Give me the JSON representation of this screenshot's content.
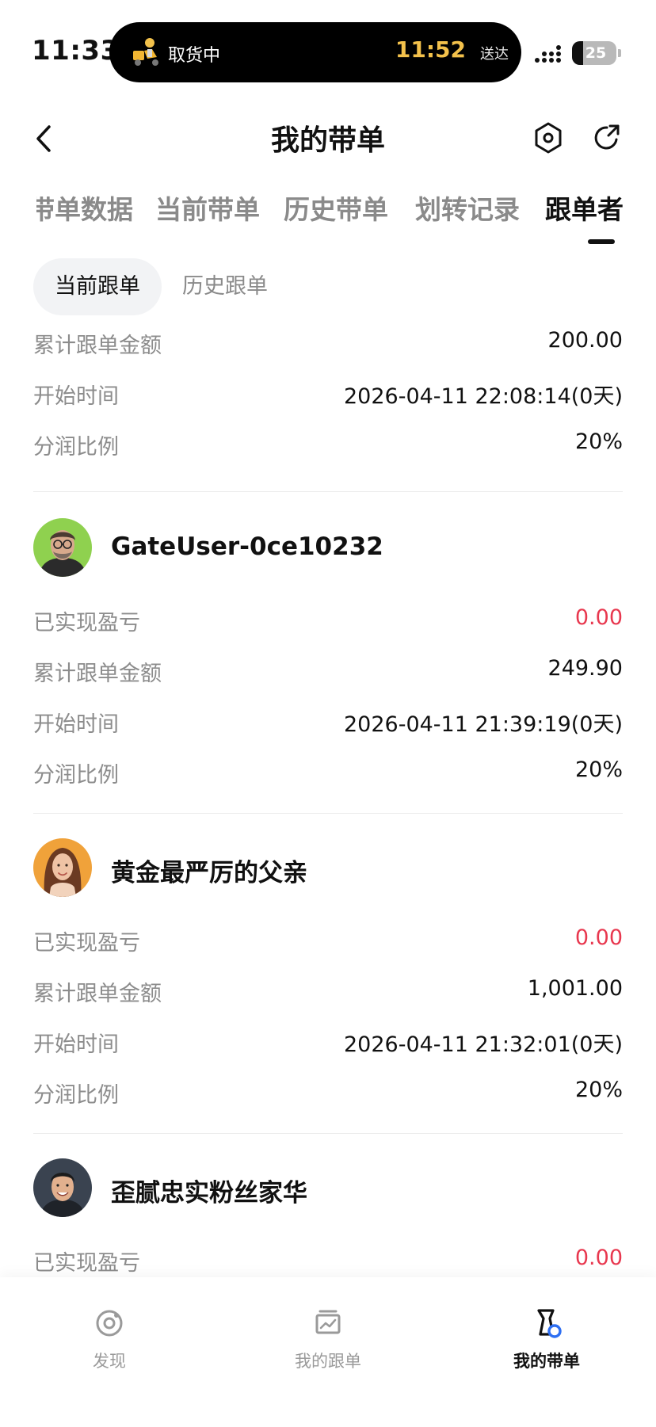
{
  "status_bar": {
    "time": "11:33",
    "delivery_status": "取货中",
    "delivery_eta": "11:52",
    "delivery_eta_suffix": "送达",
    "battery": "25"
  },
  "header": {
    "title": "我的带单",
    "icons": {
      "back": "chevron-left-icon",
      "settings": "hexagon-settings-icon",
      "share": "share-icon"
    }
  },
  "main_tabs": [
    {
      "label": "带单数据"
    },
    {
      "label": "当前带单"
    },
    {
      "label": "历史带单"
    },
    {
      "label": "划转记录"
    },
    {
      "label": "跟单者",
      "active": true
    }
  ],
  "sub_tabs": [
    {
      "label": "当前跟单",
      "active": true
    },
    {
      "label": "历史跟单"
    }
  ],
  "labels": {
    "realized_pnl": "已实现盈亏",
    "total_amount": "累计跟单金额",
    "start_time": "开始时间",
    "profit_share": "分润比例"
  },
  "partial_top": {
    "total_amount": "200.00",
    "start_time": "2026-04-11 22:08:14(0天)",
    "profit_share": "20%"
  },
  "followers": [
    {
      "name": "GateUser-0ce10232",
      "realized_pnl": "0.00",
      "total_amount": "249.90",
      "start_time": "2026-04-11 21:39:19(0天)",
      "profit_share": "20%"
    },
    {
      "name": "黄金最严厉的父亲",
      "realized_pnl": "0.00",
      "total_amount": "1,001.00",
      "start_time": "2026-04-11 21:32:01(0天)",
      "profit_share": "20%"
    },
    {
      "name": "歪腻忠实粉丝家华",
      "realized_pnl": "0.00"
    }
  ],
  "bottom_nav": [
    {
      "label": "发现",
      "icon": "discover-icon"
    },
    {
      "label": "我的跟单",
      "icon": "chart-board-icon"
    },
    {
      "label": "我的带单",
      "icon": "lead-trade-icon",
      "active": true
    }
  ],
  "colors": {
    "pnl": "#e8384f",
    "muted": "#8c8c8c",
    "accent_blue": "#2e6ff2"
  }
}
